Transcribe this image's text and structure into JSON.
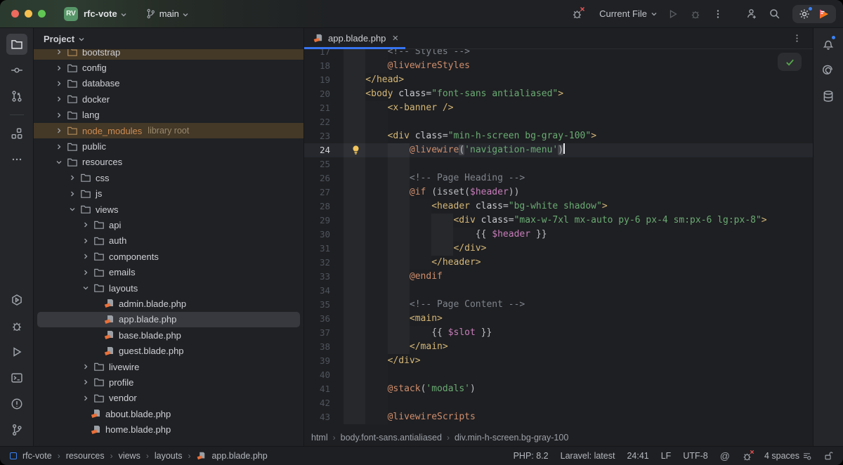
{
  "titlebar": {
    "project_badge": "RV",
    "project_name": "rfc-vote",
    "branch_name": "main",
    "run_config": "Current File"
  },
  "project_panel": {
    "header": "Project",
    "items": [
      {
        "label": "bootstrap",
        "depth": 1,
        "kind": "folder",
        "chevron": "right",
        "highlight": "ignored",
        "cut": true
      },
      {
        "label": "config",
        "depth": 1,
        "kind": "folder",
        "chevron": "right"
      },
      {
        "label": "database",
        "depth": 1,
        "kind": "folder",
        "chevron": "right"
      },
      {
        "label": "docker",
        "depth": 1,
        "kind": "folder",
        "chevron": "right"
      },
      {
        "label": "lang",
        "depth": 1,
        "kind": "folder",
        "chevron": "right"
      },
      {
        "label": "node_modules",
        "suffix": "library root",
        "depth": 1,
        "kind": "folder",
        "chevron": "right",
        "highlight": "ignored",
        "label_color": "#cd8b51"
      },
      {
        "label": "public",
        "depth": 1,
        "kind": "folder",
        "chevron": "right"
      },
      {
        "label": "resources",
        "depth": 1,
        "kind": "folder",
        "chevron": "down"
      },
      {
        "label": "css",
        "depth": 2,
        "kind": "folder",
        "chevron": "right"
      },
      {
        "label": "js",
        "depth": 2,
        "kind": "folder",
        "chevron": "right"
      },
      {
        "label": "views",
        "depth": 2,
        "kind": "folder",
        "chevron": "down"
      },
      {
        "label": "api",
        "depth": 3,
        "kind": "folder",
        "chevron": "right"
      },
      {
        "label": "auth",
        "depth": 3,
        "kind": "folder",
        "chevron": "right"
      },
      {
        "label": "components",
        "depth": 3,
        "kind": "folder",
        "chevron": "right"
      },
      {
        "label": "emails",
        "depth": 3,
        "kind": "folder",
        "chevron": "right"
      },
      {
        "label": "layouts",
        "depth": 3,
        "kind": "folder",
        "chevron": "down"
      },
      {
        "label": "admin.blade.php",
        "depth": 4,
        "kind": "blade-file"
      },
      {
        "label": "app.blade.php",
        "depth": 4,
        "kind": "blade-file",
        "highlight": "selected"
      },
      {
        "label": "base.blade.php",
        "depth": 4,
        "kind": "blade-file"
      },
      {
        "label": "guest.blade.php",
        "depth": 4,
        "kind": "blade-file"
      },
      {
        "label": "livewire",
        "depth": 3,
        "kind": "folder",
        "chevron": "right"
      },
      {
        "label": "profile",
        "depth": 3,
        "kind": "folder",
        "chevron": "right"
      },
      {
        "label": "vendor",
        "depth": 3,
        "kind": "folder",
        "chevron": "right"
      },
      {
        "label": "about.blade.php",
        "depth": 3,
        "kind": "blade-file"
      },
      {
        "label": "home.blade.php",
        "depth": 3,
        "kind": "blade-file"
      }
    ]
  },
  "editor": {
    "tab_title": "app.blade.php",
    "breadcrumbs": [
      "html",
      "body.font-sans.antialiased",
      "div.min-h-screen.bg-gray-100"
    ],
    "lines": [
      {
        "n": 17,
        "ind": 2,
        "seg": [
          [
            "cmt",
            "<!-- Styles -->"
          ]
        ]
      },
      {
        "n": 18,
        "ind": 2,
        "seg": [
          [
            "dir",
            "@livewireStyles"
          ]
        ]
      },
      {
        "n": 19,
        "ind": 1,
        "seg": [
          [
            "tag",
            "</head>"
          ]
        ]
      },
      {
        "n": 20,
        "ind": 1,
        "seg": [
          [
            "tag",
            "<body"
          ],
          [
            "plain",
            " "
          ],
          [
            "attr",
            "class"
          ],
          [
            "plain",
            "="
          ],
          [
            "str",
            "\"font-sans antialiased\""
          ],
          [
            "tag",
            ">"
          ]
        ]
      },
      {
        "n": 21,
        "ind": 2,
        "seg": [
          [
            "tag",
            "<x-banner />"
          ]
        ]
      },
      {
        "n": 22,
        "ind": 2,
        "seg": []
      },
      {
        "n": 23,
        "ind": 2,
        "seg": [
          [
            "tag",
            "<div"
          ],
          [
            "plain",
            " "
          ],
          [
            "attr",
            "class"
          ],
          [
            "plain",
            "="
          ],
          [
            "str",
            "\"min-h-screen bg-gray-100\""
          ],
          [
            "tag",
            ">"
          ]
        ]
      },
      {
        "n": 24,
        "ind": 3,
        "current": true,
        "bulb": true,
        "seg": [
          [
            "dir",
            "@livewire"
          ],
          [
            "match",
            "("
          ],
          [
            "str",
            "'navigation-menu'"
          ],
          [
            "match",
            ")"
          ],
          [
            "caret",
            ""
          ]
        ]
      },
      {
        "n": 25,
        "ind": 3,
        "seg": []
      },
      {
        "n": 26,
        "ind": 3,
        "seg": [
          [
            "cmt",
            "<!-- Page Heading -->"
          ]
        ]
      },
      {
        "n": 27,
        "ind": 3,
        "seg": [
          [
            "dir",
            "@if"
          ],
          [
            "plain",
            " (isset("
          ],
          [
            "var",
            "$header"
          ],
          [
            "plain",
            "))"
          ]
        ]
      },
      {
        "n": 28,
        "ind": 4,
        "seg": [
          [
            "tag",
            "<header"
          ],
          [
            "plain",
            " "
          ],
          [
            "attr",
            "class"
          ],
          [
            "plain",
            "="
          ],
          [
            "str",
            "\"bg-white shadow\""
          ],
          [
            "tag",
            ">"
          ]
        ]
      },
      {
        "n": 29,
        "ind": 5,
        "seg": [
          [
            "tag",
            "<div"
          ],
          [
            "plain",
            " "
          ],
          [
            "attr",
            "class"
          ],
          [
            "plain",
            "="
          ],
          [
            "str",
            "\"max-w-7xl mx-auto py-6 px-4 sm:px-6 lg:px-8\""
          ],
          [
            "tag",
            ">"
          ]
        ]
      },
      {
        "n": 30,
        "ind": 6,
        "seg": [
          [
            "plain",
            "{{ "
          ],
          [
            "var",
            "$header"
          ],
          [
            "plain",
            " }}"
          ]
        ]
      },
      {
        "n": 31,
        "ind": 5,
        "seg": [
          [
            "tag",
            "</div>"
          ]
        ]
      },
      {
        "n": 32,
        "ind": 4,
        "seg": [
          [
            "tag",
            "</header>"
          ]
        ]
      },
      {
        "n": 33,
        "ind": 3,
        "seg": [
          [
            "dir",
            "@endif"
          ]
        ]
      },
      {
        "n": 34,
        "ind": 3,
        "seg": []
      },
      {
        "n": 35,
        "ind": 3,
        "seg": [
          [
            "cmt",
            "<!-- Page Content -->"
          ]
        ]
      },
      {
        "n": 36,
        "ind": 3,
        "seg": [
          [
            "tag",
            "<main>"
          ]
        ]
      },
      {
        "n": 37,
        "ind": 4,
        "seg": [
          [
            "plain",
            "{{ "
          ],
          [
            "var",
            "$slot"
          ],
          [
            "plain",
            " }}"
          ]
        ]
      },
      {
        "n": 38,
        "ind": 3,
        "seg": [
          [
            "tag",
            "</main>"
          ]
        ]
      },
      {
        "n": 39,
        "ind": 2,
        "seg": [
          [
            "tag",
            "</div>"
          ]
        ]
      },
      {
        "n": 40,
        "ind": 2,
        "seg": []
      },
      {
        "n": 41,
        "ind": 2,
        "seg": [
          [
            "dir",
            "@stack"
          ],
          [
            "plain",
            "("
          ],
          [
            "str",
            "'modals'"
          ],
          [
            "plain",
            ")"
          ]
        ]
      },
      {
        "n": 42,
        "ind": 2,
        "seg": []
      },
      {
        "n": 43,
        "ind": 2,
        "seg": [
          [
            "dir",
            "@livewireScripts"
          ]
        ]
      }
    ]
  },
  "status_bar": {
    "path": [
      "rfc-vote",
      "resources",
      "views",
      "layouts",
      "app.blade.php"
    ],
    "php": "PHP: 8.2",
    "laravel": "Laravel: latest",
    "caret_pos": "24:41",
    "line_ending": "LF",
    "encoding": "UTF-8",
    "indent": "4 spaces"
  },
  "colors": {
    "accent_blue": "#3674f0",
    "string_green": "#6aab73",
    "tag_yellow": "#d5b778",
    "directive_orange": "#cf8e6d",
    "variable_pink": "#c77dbb",
    "ignored_row_bg": "#443827",
    "selected_row_bg": "#37393e",
    "traffic_lights": [
      "#ec6a5e",
      "#f5bf4f",
      "#61c554"
    ]
  }
}
